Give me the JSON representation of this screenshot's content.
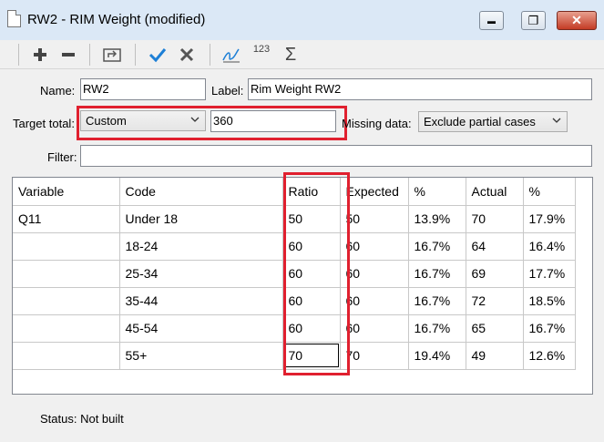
{
  "window": {
    "title": "RW2 - RIM Weight (modified)",
    "minimize": "▬",
    "restore": "❐",
    "close": "✕"
  },
  "toolbar": {
    "icons": [
      "plus-icon",
      "minus-icon",
      "folder-up-icon",
      "check-icon",
      "cross-icon",
      "signature-icon",
      "numbering-icon",
      "sigma-icon"
    ],
    "numbering_glyph": "123",
    "sigma_glyph": "Σ"
  },
  "form": {
    "name_label": "Name:",
    "name_value": "RW2",
    "label_label": "Label:",
    "label_value": "Rim Weight RW2",
    "target_total_label": "Target total:",
    "target_total_mode": "Custom",
    "target_total_value": "360",
    "missing_data_label": "Missing data:",
    "missing_data_value": "Exclude partial cases",
    "filter_label": "Filter:",
    "filter_value": ""
  },
  "table": {
    "headers": [
      "Variable",
      "Code",
      "Ratio",
      "Expected",
      "%",
      "Actual",
      "%"
    ],
    "rows": [
      [
        "Q11",
        "Under 18",
        "50",
        "50",
        "13.9%",
        "70",
        "17.9%"
      ],
      [
        "",
        "18-24",
        "60",
        "60",
        "16.7%",
        "64",
        "16.4%"
      ],
      [
        "",
        "25-34",
        "60",
        "60",
        "16.7%",
        "69",
        "17.7%"
      ],
      [
        "",
        "35-44",
        "60",
        "60",
        "16.7%",
        "72",
        "18.5%"
      ],
      [
        "",
        "45-54",
        "60",
        "60",
        "16.7%",
        "65",
        "16.7%"
      ],
      [
        "",
        "55+",
        "70",
        "70",
        "19.4%",
        "49",
        "12.6%"
      ]
    ]
  },
  "status": {
    "label": "Status:",
    "value": "Not built"
  },
  "colors": {
    "highlight": "#e0202f",
    "titlebar": "#dbe8f6",
    "check_blue": "#1d7fd6"
  }
}
